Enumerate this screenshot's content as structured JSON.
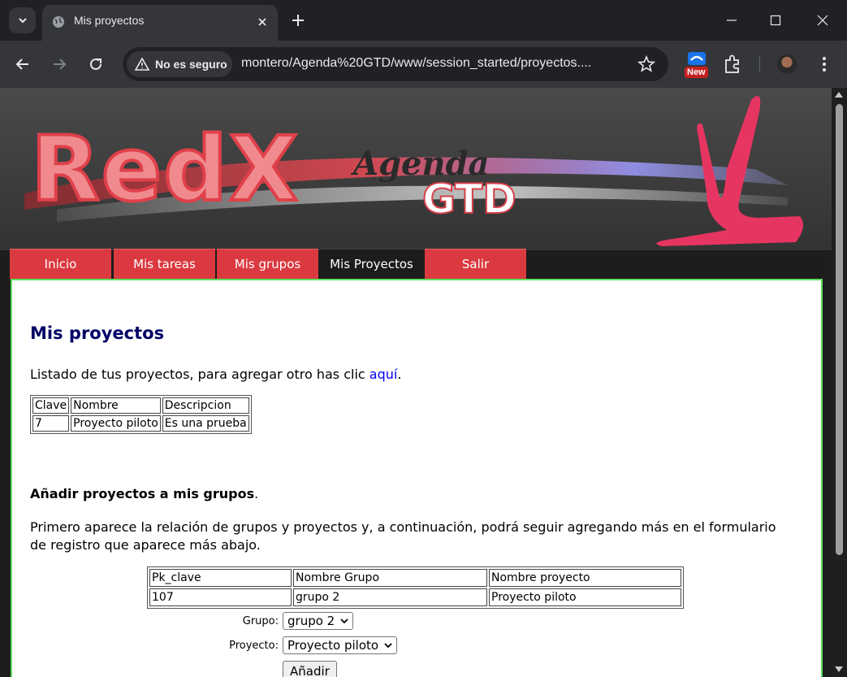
{
  "browser": {
    "tab_title": "Mis proyectos",
    "security_label": "No es seguro",
    "url": "montero/Agenda%20GTD/www/session_started/proyectos....",
    "extension_badge": "New"
  },
  "banner": {
    "brand": "RedX",
    "subtitle_script": "Agenda",
    "subtitle_caps": "GTD"
  },
  "nav": {
    "items": [
      {
        "label": "Inicio",
        "active": false
      },
      {
        "label": "Mis tareas",
        "active": false
      },
      {
        "label": "Mis grupos",
        "active": false
      },
      {
        "label": "Mis Proyectos",
        "active": true
      },
      {
        "label": "Salir",
        "active": false
      }
    ]
  },
  "main": {
    "title": "Mis proyectos",
    "intro_text": "Listado de tus proyectos, para agregar otro has clic ",
    "intro_link": "aquí",
    "intro_end": ".",
    "projects_table": {
      "headers": [
        "Clave",
        "Nombre",
        "Descripcion"
      ],
      "rows": [
        [
          "7",
          "Proyecto piloto",
          "Es una prueba"
        ]
      ]
    },
    "add_section_title": "Añadir proyectos a mis grupos",
    "add_section_title_end": ".",
    "add_section_text": "Primero aparece la relación de grupos y proyectos y, a continuación, podrá seguir agregando más en el formulario de registro que aparece más abajo.",
    "groups_table": {
      "headers": [
        "Pk_clave",
        "Nombre Grupo",
        "Nombre proyecto"
      ],
      "rows": [
        [
          "107",
          "grupo 2",
          "Proyecto piloto"
        ]
      ]
    },
    "form": {
      "group_label": "Grupo:",
      "group_value": "grupo 2",
      "project_label": "Proyecto:",
      "project_value": "Proyecto piloto",
      "submit_label": "Añadir"
    }
  },
  "colors": {
    "nav_bg": "#db3940",
    "nav_active_bg": "#1c1c1c",
    "content_border": "#5ee05e",
    "title_color": "#000066",
    "link_color": "#0000ee"
  }
}
